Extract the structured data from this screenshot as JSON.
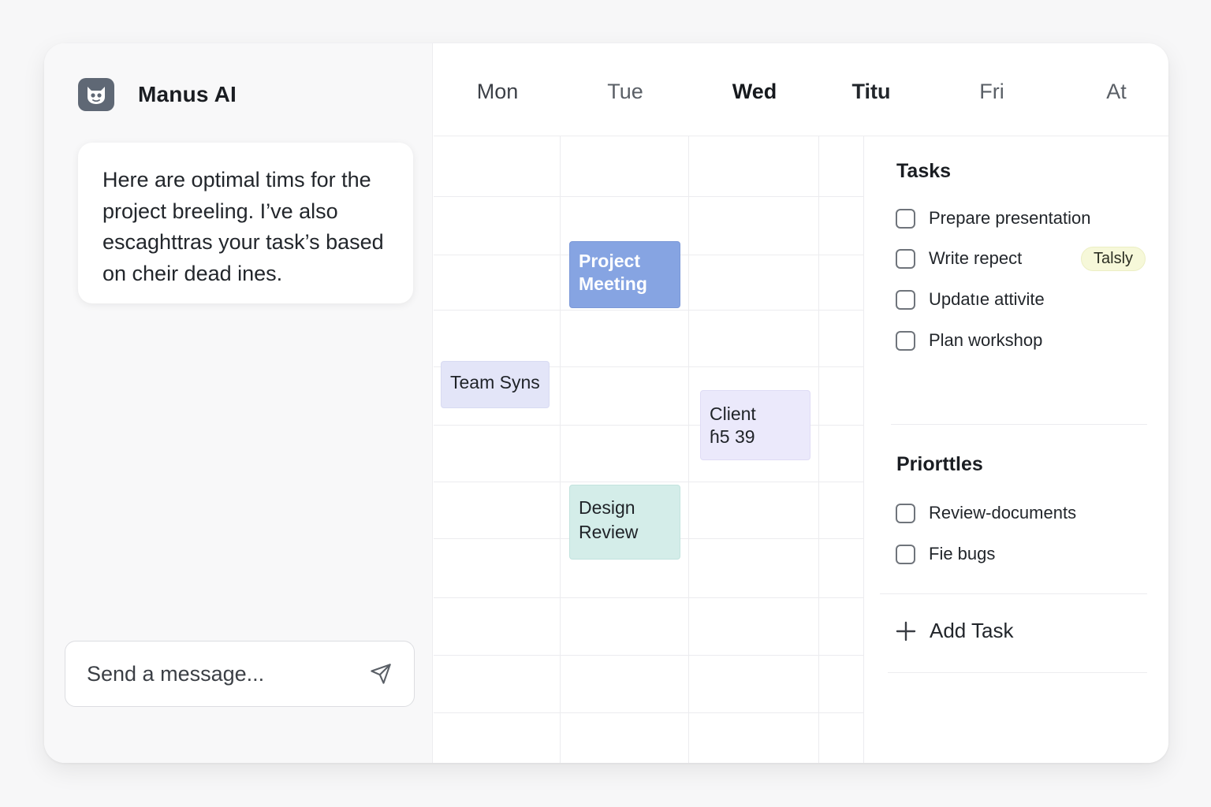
{
  "app": {
    "name": "Manus AI"
  },
  "chat": {
    "assistant_message": "Here are optimal tims for the project breeling. I’ve also escaghttras your task’s based on cheir dead ines.",
    "composer": {
      "placeholder": "Send a message...",
      "send_icon": "send-icon"
    }
  },
  "calendar": {
    "days": [
      "Mon",
      "Tue",
      "Wed",
      "Titu",
      "Fri",
      "At"
    ],
    "events": [
      {
        "title": "Project Meeting",
        "day": "Tue",
        "color": "#86a4e2"
      },
      {
        "title": "Team Syns",
        "day": "Mon",
        "color": "#e3e5f8"
      },
      {
        "title": "Client",
        "detail": "ɦ5 39",
        "day": "Wed",
        "color": "#ebe9fb"
      },
      {
        "title": "Design Review",
        "day": "Tue",
        "color": "#d4ede9"
      }
    ]
  },
  "tasks": {
    "title": "Tasks",
    "items": [
      {
        "label": "Prepare presentation",
        "checked": false
      },
      {
        "label": "Write repect",
        "checked": false,
        "tag": "Talsly"
      },
      {
        "label": "Updatıe attivite",
        "checked": false
      },
      {
        "label": "Plan workshop",
        "checked": false
      }
    ]
  },
  "priorities": {
    "title": "Priorttles",
    "items": [
      {
        "label": "Review-documents",
        "checked": false
      },
      {
        "label": "Fie bugs",
        "checked": false
      }
    ]
  },
  "add_task": {
    "label": "Add Task",
    "icon": "plus-icon"
  },
  "colors": {
    "accent": "#86a4e2",
    "brand_icon_bg": "#5f6875",
    "tag_bg": "#f6f8d9"
  }
}
